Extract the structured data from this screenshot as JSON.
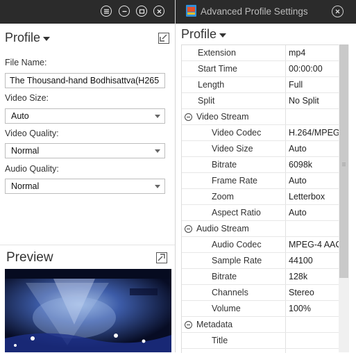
{
  "left_panel": {
    "profile_heading": "Profile",
    "file_name_label": "File Name:",
    "file_name_value": "The Thousand-hand Bodhisattva(H265",
    "video_size_label": "Video Size:",
    "video_size_value": "Auto",
    "video_quality_label": "Video Quality:",
    "video_quality_value": "Normal",
    "audio_quality_label": "Audio Quality:",
    "audio_quality_value": "Normal",
    "preview_heading": "Preview"
  },
  "dialog": {
    "title": "Advanced Profile Settings",
    "profile_heading": "Profile",
    "rows": [
      {
        "key": "Extension",
        "value": "mp4",
        "level": 1
      },
      {
        "key": "Start Time",
        "value": "00:00:00",
        "level": 1
      },
      {
        "key": "Length",
        "value": "Full",
        "level": 1
      },
      {
        "key": "Split",
        "value": "No Split",
        "level": 1
      },
      {
        "key": "Video Stream",
        "value": "",
        "level": 0
      },
      {
        "key": "Video Codec",
        "value": "H.264/MPEG",
        "level": 2
      },
      {
        "key": "Video Size",
        "value": "Auto",
        "level": 2
      },
      {
        "key": "Bitrate",
        "value": "6098k",
        "level": 2
      },
      {
        "key": "Frame Rate",
        "value": "Auto",
        "level": 2
      },
      {
        "key": "Zoom",
        "value": "Letterbox",
        "level": 2
      },
      {
        "key": "Aspect Ratio",
        "value": "Auto",
        "level": 2
      },
      {
        "key": "Audio Stream",
        "value": "",
        "level": 0
      },
      {
        "key": "Audio Codec",
        "value": "MPEG-4 AAC",
        "level": 2
      },
      {
        "key": "Sample Rate",
        "value": "44100",
        "level": 2
      },
      {
        "key": "Bitrate",
        "value": "128k",
        "level": 2
      },
      {
        "key": "Channels",
        "value": "Stereo",
        "level": 2
      },
      {
        "key": "Volume",
        "value": "100%",
        "level": 2
      },
      {
        "key": "Metadata",
        "value": "",
        "level": 0
      },
      {
        "key": "Title",
        "value": "",
        "level": 2
      },
      {
        "key": "",
        "value": "",
        "level": 2
      }
    ]
  },
  "icons": {
    "window_controls": [
      "menu-icon",
      "minimize-icon",
      "restore-icon",
      "close-icon"
    ],
    "dialog_close": "close-icon",
    "expand": "expand-icon",
    "group_toggle": "collapse-minus-icon"
  },
  "colors": {
    "titlebar_bg": "#2b2b2b",
    "titlebar_text": "#bcbcbc",
    "border": "#bdbdbd",
    "scroll_thumb": "#c9c9c9"
  }
}
